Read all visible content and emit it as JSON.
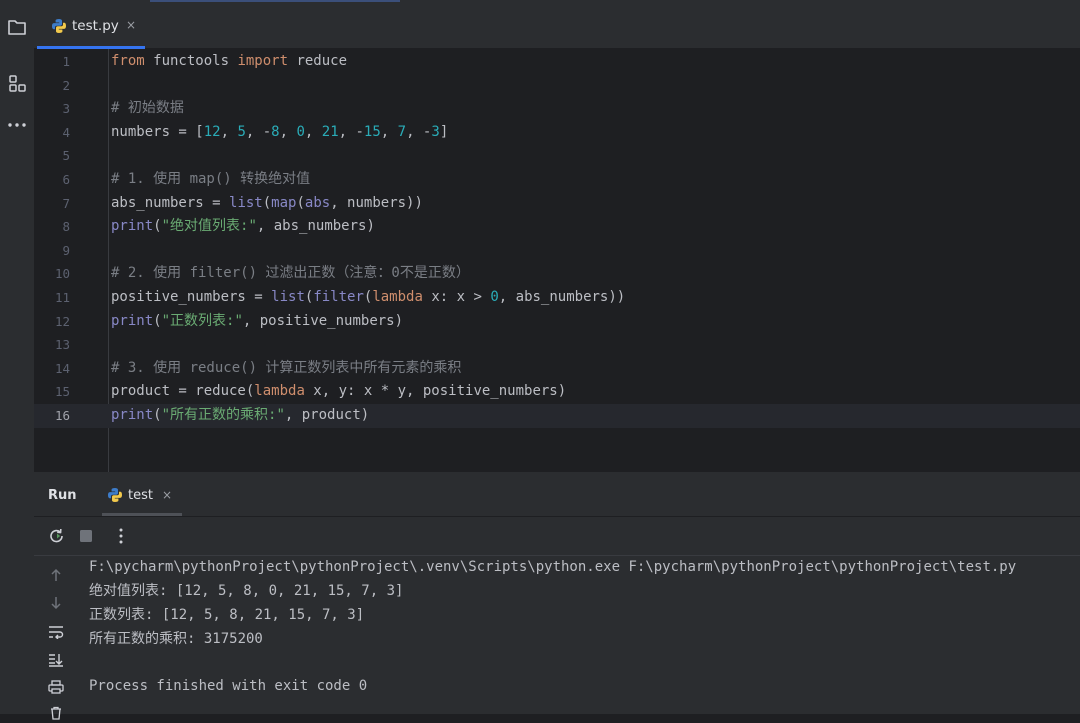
{
  "editor": {
    "tab": {
      "label": "test.py",
      "close": "×",
      "icon": "python-file-icon"
    },
    "line_numbers": [
      "1",
      "2",
      "3",
      "4",
      "5",
      "6",
      "7",
      "8",
      "9",
      "10",
      "11",
      "12",
      "13",
      "14",
      "15",
      "16"
    ],
    "code": {
      "l1": {
        "from": "from",
        "mod": " functools ",
        "import": "import",
        "name": " reduce"
      },
      "l3": {
        "comment": "# 初始数据"
      },
      "l4": {
        "pre": "numbers = [",
        "v1": "12",
        "c1": ", ",
        "v2": "5",
        "c2": ", -",
        "v3": "8",
        "c3": ", ",
        "v4": "0",
        "c4": ", ",
        "v5": "21",
        "c5": ", -",
        "v6": "15",
        "c6": ", ",
        "v7": "7",
        "c7": ", -",
        "v8": "3",
        "end": "]"
      },
      "l6": {
        "comment": "# 1. 使用 map() 转换绝对值"
      },
      "l7": {
        "pre": "abs_numbers = ",
        "list": "list",
        "p1": "(",
        "map": "map",
        "p2": "(",
        "abs": "abs",
        "rest": ", numbers))"
      },
      "l8": {
        "print": "print",
        "p1": "(",
        "str": "\"绝对值列表:\"",
        "rest": ", abs_numbers)"
      },
      "l10": {
        "comment": "# 2. 使用 filter() 过滤出正数（注意：0不是正数）"
      },
      "l11": {
        "pre": "positive_numbers = ",
        "list": "list",
        "p1": "(",
        "filter": "filter",
        "p2": "(",
        "lambda": "lambda",
        "mid": " x: x > ",
        "zero": "0",
        "rest": ", abs_numbers))"
      },
      "l12": {
        "print": "print",
        "p1": "(",
        "str": "\"正数列表:\"",
        "rest": ", positive_numbers)"
      },
      "l14": {
        "comment": "# 3. 使用 reduce() 计算正数列表中所有元素的乘积"
      },
      "l15": {
        "pre": "product = reduce(",
        "lambda": "lambda",
        "rest": " x, y: x * y, positive_numbers)"
      },
      "l16": {
        "print": "print",
        "p1": "(",
        "str": "\"所有正数的乘积:\"",
        "rest": ", product)"
      }
    }
  },
  "run_panel": {
    "title": "Run",
    "tab": {
      "label": "test",
      "close": "×",
      "icon": "python-file-icon"
    },
    "toolbar": {
      "rerun_icon": "rerun-icon",
      "stop_icon": "stop-icon",
      "more_icon": "more-icon"
    },
    "side_icons": [
      "up-arrow-icon",
      "down-arrow-icon",
      "soft-wrap-icon",
      "scroll-to-end-icon",
      "print-icon",
      "delete-icon"
    ],
    "output": [
      "F:\\pycharm\\pythonProject\\pythonProject\\.venv\\Scripts\\python.exe F:\\pycharm\\pythonProject\\pythonProject\\test.py",
      "绝对值列表: [12, 5, 8, 0, 21, 15, 7, 3]",
      "正数列表: [12, 5, 8, 21, 15, 7, 3]",
      "所有正数的乘积: 3175200",
      "",
      "Process finished with exit code 0"
    ]
  },
  "sidebar": {
    "icons": [
      "project-folder-icon",
      "structure-icon",
      "more-tools-icon"
    ]
  },
  "colors": {
    "keyword": "#cf8e6d",
    "number": "#2aacb8",
    "string": "#6aab73",
    "builtin": "#8888c6",
    "comment": "#7a7e85",
    "accent": "#3574f0"
  }
}
